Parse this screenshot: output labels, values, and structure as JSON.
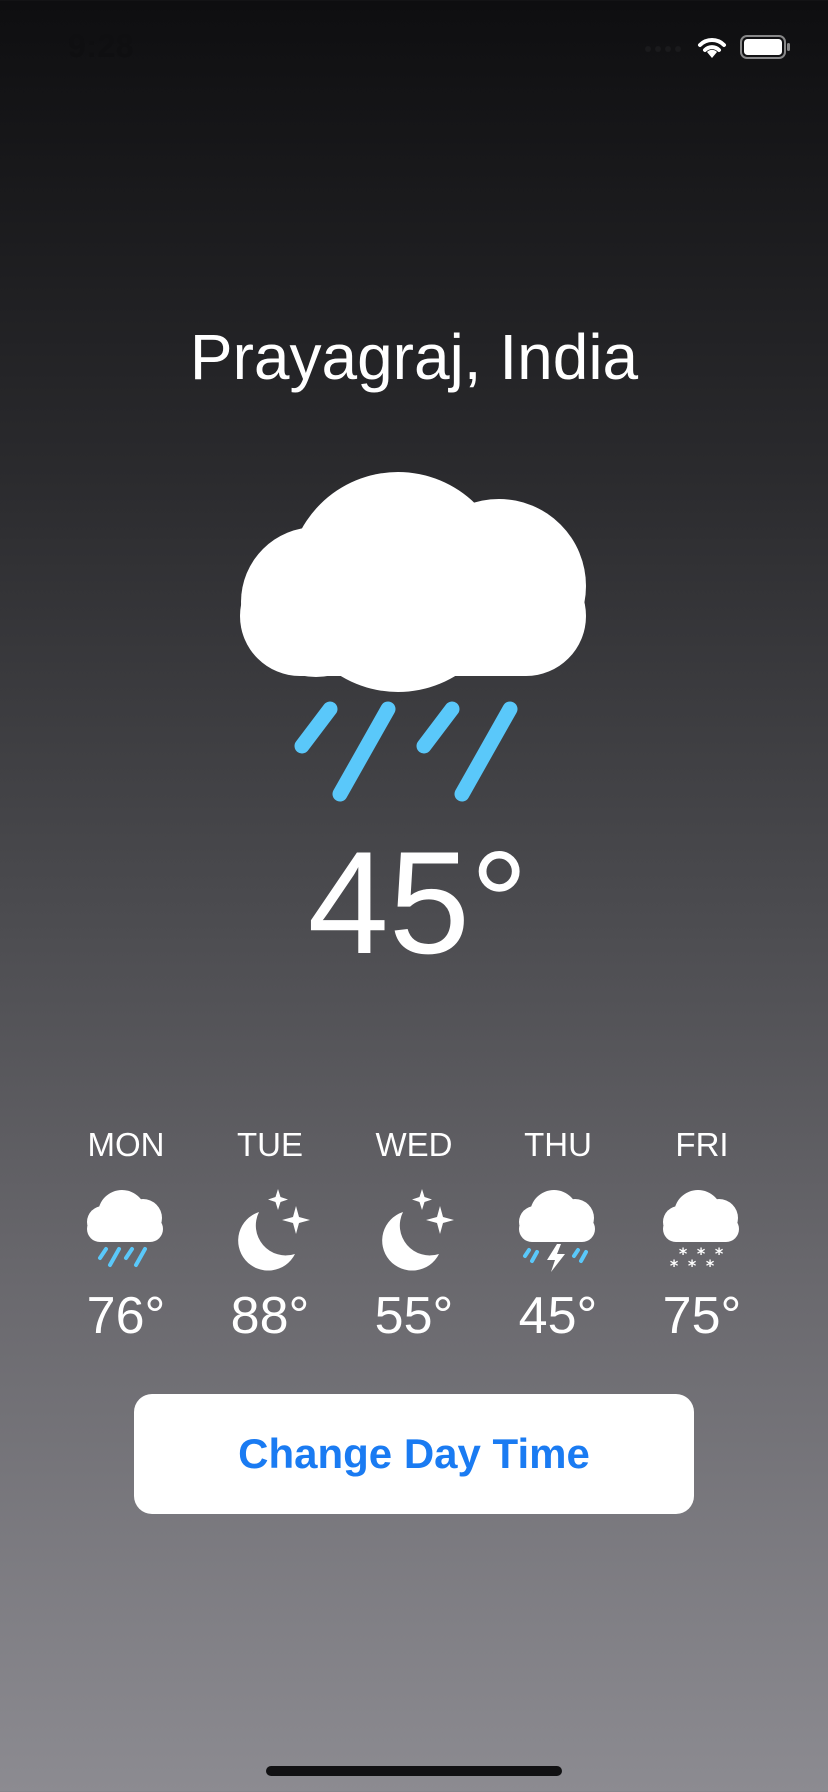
{
  "status_bar": {
    "time": "9:28",
    "icons": [
      "signal-icon",
      "wifi-icon",
      "battery-icon"
    ]
  },
  "location": "Prayagraj, India",
  "current": {
    "icon": "cloud-rain-icon",
    "temperature": "45°"
  },
  "forecast": [
    {
      "day": "MON",
      "icon": "cloud-rain-icon",
      "temp": "76°"
    },
    {
      "day": "TUE",
      "icon": "moon-stars-icon",
      "temp": "88°"
    },
    {
      "day": "WED",
      "icon": "moon-stars-icon",
      "temp": "55°"
    },
    {
      "day": "THU",
      "icon": "cloud-bolt-rain-icon",
      "temp": "45°"
    },
    {
      "day": "FRI",
      "icon": "cloud-snow-icon",
      "temp": "75°"
    }
  ],
  "button": {
    "label": "Change Day Time"
  },
  "colors": {
    "accent": "#1a7bf2",
    "rain": "#5ac8fa",
    "background_top": "#0e0e10",
    "background_bottom": "#8c8b91"
  }
}
